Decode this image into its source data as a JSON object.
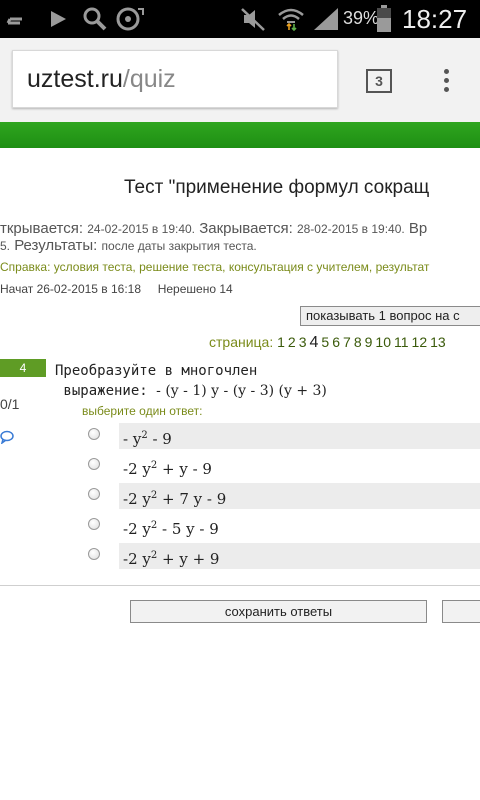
{
  "status_bar": {
    "battery_percent": "39%",
    "time": "18:27",
    "icons": [
      "zzz-icon",
      "play-icon",
      "search-icon",
      "media-icon",
      "mute-icon",
      "wifi-icon",
      "signal-icon",
      "battery-icon"
    ]
  },
  "browser": {
    "url_host": "uztest.ru",
    "url_path": "/quiz",
    "tab_count": "3"
  },
  "page": {
    "title": "Тест \"применение формул сокращ",
    "opens_label": "ткрывается:",
    "opens_value": "24-02-2015 в 19:40.",
    "closes_label": "Закрывается:",
    "closes_value": "28-02-2015 в 19:40.",
    "time_cut": "Вр",
    "row2_prefix": "5.",
    "results_label": "Результаты:",
    "results_value": "после даты закрытия теста.",
    "help_label": "Справка:",
    "help_links": [
      "условия теста",
      "решение теста",
      "консультация с учителем",
      "результат"
    ],
    "started_label": "Начат",
    "started_value": "26-02-2015 в 16:18",
    "unsolved": "Нерешено 14",
    "show_button": "показывать 1 вопрос на с",
    "pager_label": "страница:",
    "pages": [
      "1",
      "2",
      "3",
      "4",
      "5",
      "6",
      "7",
      "8",
      "9",
      "10",
      "11",
      "12",
      "13"
    ],
    "current_page": "4"
  },
  "question": {
    "number": "4",
    "score": "0/1",
    "line1": "Преобразуйте в многочлен",
    "line2": " выражение:",
    "expression": "- (y - 1) y - (y - 3) (y + 3)",
    "choose_hint": "выберите один ответ:",
    "answers": [
      {
        "pre": "- y",
        "sup": "2",
        "post": " - 9"
      },
      {
        "pre": "-2 y",
        "sup": "2",
        "post": " + y - 9"
      },
      {
        "pre": "-2 y",
        "sup": "2",
        "post": " + 7 y - 9"
      },
      {
        "pre": "-2 y",
        "sup": "2",
        "post": " - 5 y - 9"
      },
      {
        "pre": "-2 y",
        "sup": "2",
        "post": " + y + 9"
      }
    ]
  },
  "actions": {
    "save_label": "сохранить ответы"
  }
}
